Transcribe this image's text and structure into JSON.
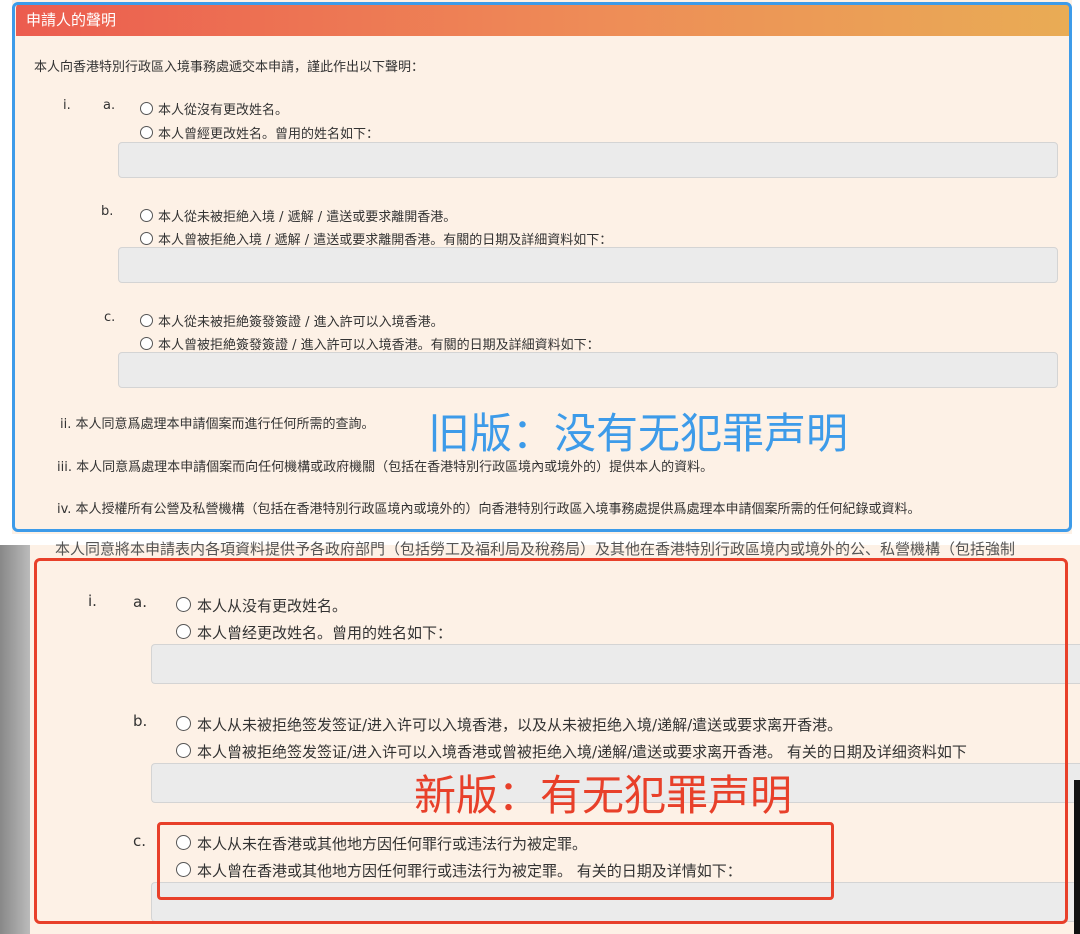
{
  "old_form": {
    "header": "申請人的聲明",
    "intro": "本人向香港特別行政區入境事務處遞交本申請，謹此作出以下聲明：",
    "item_i": "i.",
    "a": {
      "marker": "a.",
      "opt1": "本人從沒有更改姓名。",
      "opt2": "本人曾經更改姓名。曾用的姓名如下："
    },
    "b": {
      "marker": "b.",
      "opt1": "本人從未被拒絶入境 / 遞解 / 遣送或要求離開香港。",
      "opt2": "本人曾被拒絶入境 / 遞解 / 遣送或要求離開香港。有關的日期及詳細資料如下："
    },
    "c": {
      "marker": "c.",
      "opt1": "本人從未被拒絶簽發簽證 / 進入許可以入境香港。",
      "opt2": "本人曾被拒絶簽發簽證 / 進入許可以入境香港。有關的日期及詳細資料如下："
    },
    "ii": "ii. 本人同意爲處理本申請個案而進行任何所需的查詢。",
    "iii": "iii. 本人同意爲處理本申請個案而向任何機構或政府機關（包括在香港特別行政區境內或境外的）提供本人的資料。",
    "iv": "iv. 本人授權所有公營及私營機構（包括在香港特別行政區境內或境外的）向香港特別行政區入境事務處提供爲處理本申請個案所需的任何紀錄或資料。",
    "annotation": "旧版：没有无犯罪声明"
  },
  "new_form": {
    "cut_line": "本人同意將本申請表内各項資料提供予各政府部門（包括勞工及福利局及稅務局）及其他在香港特別行政區境内或境外的公、私營機構（包括強制",
    "item_i": "i.",
    "a": {
      "marker": "a.",
      "opt1": "本人从没有更改姓名。",
      "opt2": "本人曾经更改姓名。曾用的姓名如下："
    },
    "b": {
      "marker": "b.",
      "opt1": "本人从未被拒绝签发签证/进入许可以入境香港，以及从未被拒绝入境/递解/遣送或要求离开香港。",
      "opt2": "本人曾被拒绝签发签证/进入许可以入境香港或曾被拒绝入境/递解/遣送或要求离开香港。 有关的日期及详细资料如下"
    },
    "c": {
      "marker": "c.",
      "opt1": "本人从未在香港或其他地方因任何罪行或违法行为被定罪。",
      "opt2": "本人曾在香港或其他地方因任何罪行或违法行为被定罪。 有关的日期及详情如下："
    },
    "annotation": "新版：有无犯罪声明"
  },
  "colors": {
    "blue_frame": "#3d9be9",
    "red_frame": "#e8402a",
    "header_start": "#ec5c4f",
    "header_end": "#e9ac55",
    "panel_bg": "#fdf1e6"
  }
}
